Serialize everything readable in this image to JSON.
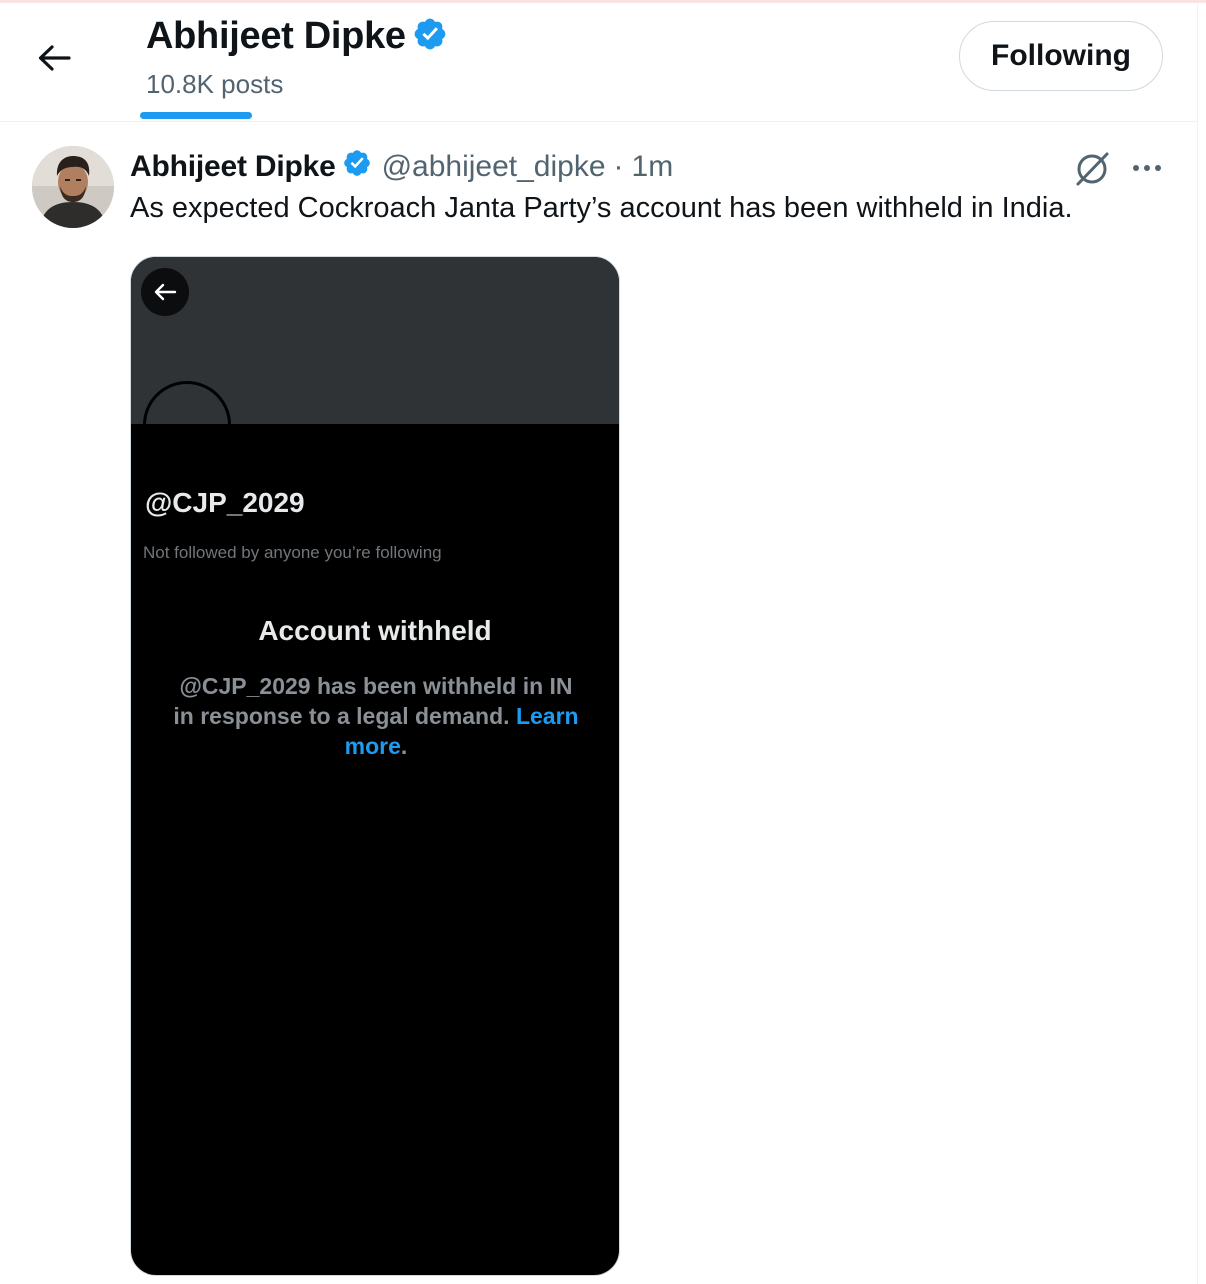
{
  "header": {
    "profile_name": "Abhijeet Dipke",
    "post_count": "10.8K posts",
    "follow_button": "Following"
  },
  "tweet": {
    "author_name": "Abhijeet Dipke",
    "author_handle": "@abhijeet_dipke",
    "separator": "·",
    "time": "1m",
    "text": "As expected Cockroach Janta Party’s account has been withheld in India."
  },
  "media": {
    "handle": "@CJP_2029",
    "note": "Not followed by anyone you’re following",
    "title": "Account withheld",
    "line1": "@CJP_2029 has been withheld in IN",
    "line2": "in response to a legal demand.",
    "link_part1": "Learn",
    "link_part2": "more",
    "period": "."
  },
  "colors": {
    "accent": "#1d9bf0",
    "text": "#0f1419",
    "muted": "#536471",
    "border": "#cfd9de"
  },
  "icons": {
    "back": "arrow-left-icon",
    "verified": "verified-badge-icon",
    "grok": "grok-icon",
    "more": "more-horizontal-icon"
  }
}
